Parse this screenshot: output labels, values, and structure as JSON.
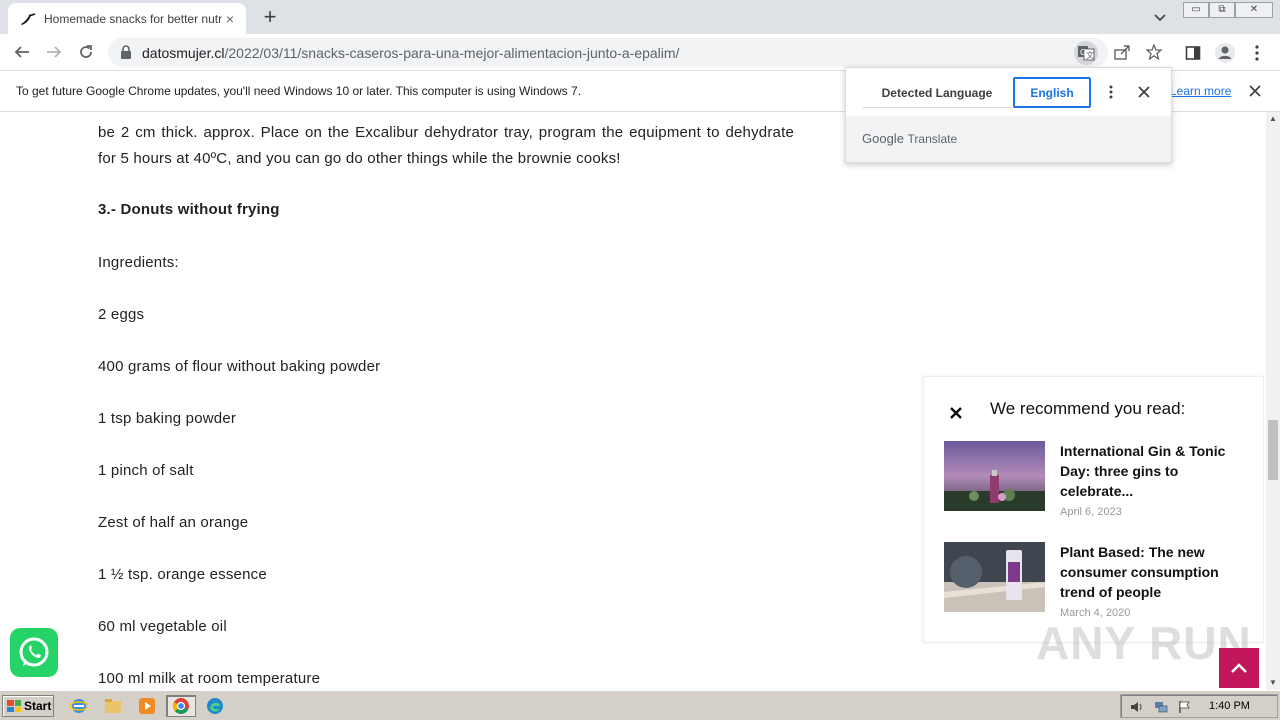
{
  "browser": {
    "tab": {
      "title": "Homemade snacks for better nutritio",
      "close_symbol": "×"
    },
    "new_tab_symbol": "+",
    "url": {
      "host": "datosmujer.cl",
      "path": "/2022/03/11/snacks-caseros-para-una-mejor-alimentacion-junto-a-epalim/"
    },
    "window_controls": [
      "▭",
      "⧉",
      "✕"
    ]
  },
  "infobar": {
    "message": "To get future Google Chrome updates, you'll need Windows 10 or later. This computer is using Windows 7.",
    "link": "Learn more"
  },
  "translate_popup": {
    "tab_detected": "Detected Language",
    "tab_target": "English",
    "brand_google": "Google",
    "brand_translate": "Translate"
  },
  "article": {
    "paragraph": "be 2 cm thick. approx. Place on the Excalibur dehydrator tray, program the equipment to dehydrate for 5 hours at 40ºC, and you can go do other things while the brownie cooks!",
    "heading": "3.- Donuts without frying",
    "ingredients_label": "Ingredients:",
    "ingredients": [
      "2 eggs",
      "400 grams of flour without baking powder",
      "1 tsp baking powder",
      "1 pinch of salt",
      "Zest of half an orange",
      "1 ½ tsp. orange essence",
      "60 ml vegetable oil",
      "100 ml milk at room temperature"
    ]
  },
  "recommend": {
    "title": "We recommend you read:",
    "items": [
      {
        "headline": "International Gin & Tonic Day: three gins to celebrate...",
        "date": "April 6, 2023"
      },
      {
        "headline": "Plant Based: The new consumer consumption trend of people",
        "date": "March 4, 2020"
      }
    ]
  },
  "watermark": "ANY RUN",
  "taskbar": {
    "start_label": "Start",
    "clock": "1:40 PM"
  },
  "colors": {
    "heading_accent": "#d81bcc",
    "to_top_button": "#c2185b",
    "whatsapp_green": "#25d366",
    "link_blue": "#1a73e8"
  },
  "icons": {
    "tab_favicon": "swoosh-icon",
    "back": "arrow-left-icon",
    "forward": "arrow-right-icon",
    "reload": "reload-icon",
    "translate": "translate-icon",
    "share": "share-icon",
    "bookmark": "star-icon",
    "side_panel": "side-panel-icon",
    "profile": "profile-icon",
    "menu": "kebab-menu-icon"
  }
}
